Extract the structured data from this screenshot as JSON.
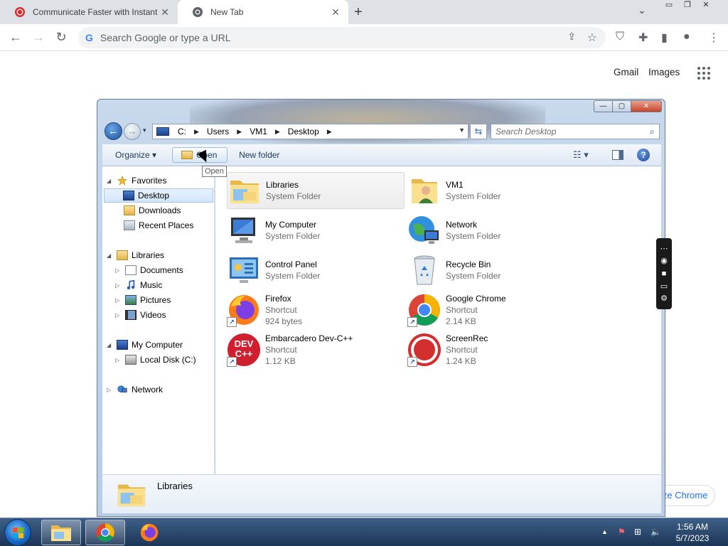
{
  "browser": {
    "tabs": [
      {
        "title": "Communicate Faster with Instant",
        "close": "✕"
      },
      {
        "title": "New Tab",
        "close": "✕"
      }
    ],
    "new_tab": "+",
    "tab_search": "⌄",
    "window_controls": {
      "minimize": "▭",
      "restore": "❐",
      "close": "✕"
    },
    "nav": {
      "back": "←",
      "forward": "→",
      "reload": "↻"
    },
    "omnibox": {
      "g_logo": "G",
      "placeholder": "Search Google or type a URL",
      "share": "⇪",
      "bookmark": "☆"
    },
    "toolbar_icons": {
      "extension1": "⛉",
      "extensions": "✚",
      "side_panel": "▮",
      "profile": "●",
      "menu": "⋮"
    },
    "ntp": {
      "gmail": "Gmail",
      "images": "Images",
      "customize": "ize Chrome"
    }
  },
  "explorer": {
    "caption": {
      "minimize": "—",
      "maximize": "▢",
      "close": "✕"
    },
    "back": "←",
    "forward": "→",
    "recent": "▾",
    "address": [
      "C:",
      "Users",
      "VM1",
      "Desktop"
    ],
    "address_arrow": "▶",
    "address_dropdown": "▼",
    "refresh": "⇆",
    "search_placeholder": "Search Desktop",
    "search_icon": "⌕",
    "command_bar": {
      "organize": "Organize ▾",
      "open": "Open",
      "new_folder": "New folder",
      "views": "☷ ▾",
      "help": "?"
    },
    "tooltip": "Open",
    "nav_tree": [
      {
        "label": "Favorites",
        "exp": "◢"
      },
      {
        "label": "Desktop",
        "exp": ""
      },
      {
        "label": "Downloads",
        "exp": ""
      },
      {
        "label": "Recent Places",
        "exp": ""
      },
      {
        "label": "Libraries",
        "exp": "◢"
      },
      {
        "label": "Documents",
        "exp": "▷"
      },
      {
        "label": "Music",
        "exp": "▷"
      },
      {
        "label": "Pictures",
        "exp": "▷"
      },
      {
        "label": "Videos",
        "exp": "▷"
      },
      {
        "label": "My Computer",
        "exp": "◢"
      },
      {
        "label": "Local Disk (C:)",
        "exp": "▷"
      },
      {
        "label": "Network",
        "exp": "▷"
      }
    ],
    "items": [
      {
        "name": "Libraries",
        "sub": "System Folder",
        "size": ""
      },
      {
        "name": "VM1",
        "sub": "System Folder",
        "size": ""
      },
      {
        "name": "My Computer",
        "sub": "System Folder",
        "size": ""
      },
      {
        "name": "Network",
        "sub": "System Folder",
        "size": ""
      },
      {
        "name": "Control Panel",
        "sub": "System Folder",
        "size": ""
      },
      {
        "name": "Recycle Bin",
        "sub": "System Folder",
        "size": ""
      },
      {
        "name": "Firefox",
        "sub": "Shortcut",
        "size": "924 bytes"
      },
      {
        "name": "Google Chrome",
        "sub": "Shortcut",
        "size": "2.14 KB"
      },
      {
        "name": "Embarcadero Dev-C++",
        "sub": "Shortcut",
        "size": "1.12 KB"
      },
      {
        "name": "ScreenRec",
        "sub": "Shortcut",
        "size": "1.24 KB"
      }
    ],
    "devcpp_logo": "DEV C++",
    "shortcut_arrow": "↗",
    "details_name": "Libraries"
  },
  "widget": {
    "grip": "⋯",
    "camera": "◉",
    "video": "■",
    "screen": "▭",
    "settings": "⚙"
  },
  "taskbar": {
    "tray_up": "▲",
    "tray_flag": "⚑",
    "tray_network": "⊞",
    "tray_volume": "🔈",
    "time": "1:56 AM",
    "date": "5/7/2023"
  }
}
